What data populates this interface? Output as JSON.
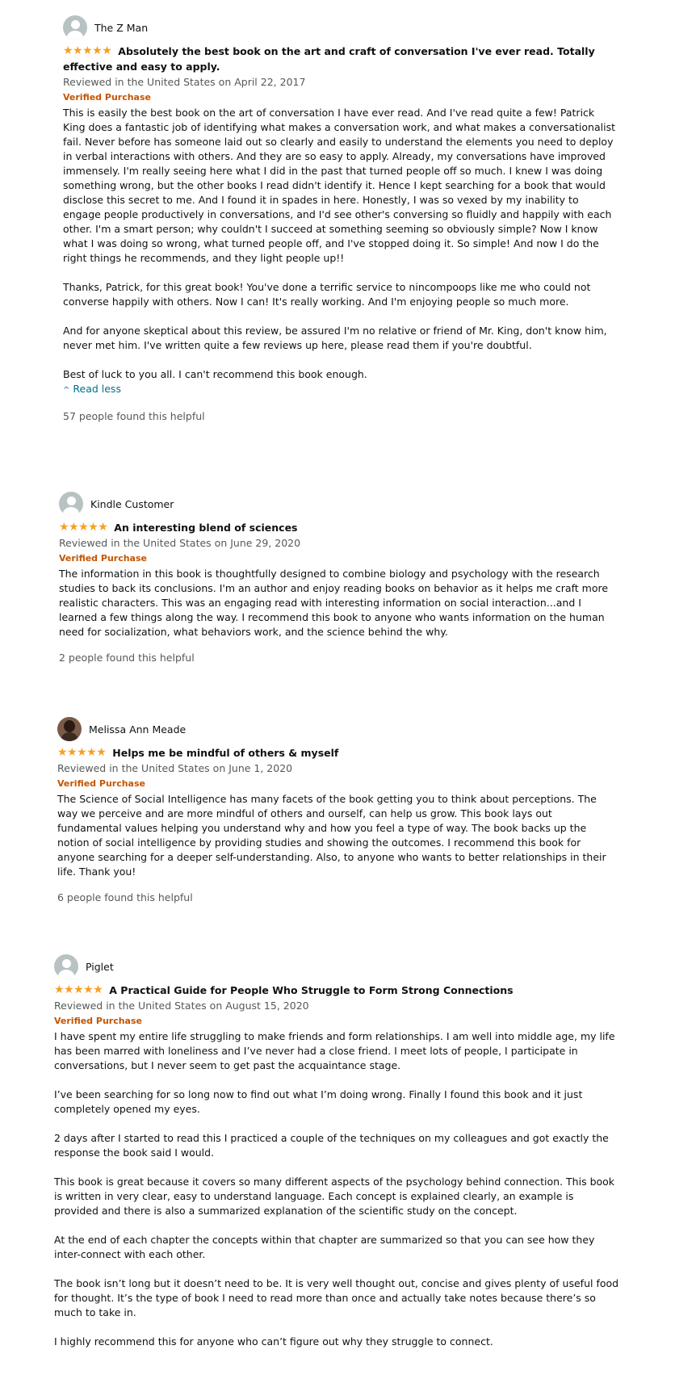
{
  "reviews": [
    {
      "profile_name": "The Z Man",
      "stars": "★★★★★",
      "title": "Absolutely the best book on the art and craft of conversation I've ever read. Totally effective and easy to apply.",
      "date": "Reviewed in the United States on April 22, 2017",
      "verified": "Verified Purchase",
      "paragraphs": [
        "This is easily the best book on the art of conversation I have ever read. And I've read quite a few! Patrick King does a fantastic job of identifying what makes a conversation work, and what makes a conversationalist fail. Never before has someone laid out so clearly and easily to understand the elements you need to deploy in verbal interactions with others. And they are so easy to apply. Already, my conversations have improved immensely. I'm really seeing here what I did in the past that turned people off so much. I knew I was doing something wrong, but the other books I read didn't identify it. Hence I kept searching for a book that would disclose this secret to me. And I found it in spades in here. Honestly, I was so vexed by my inability to engage people productively in conversations, and I'd see other's conversing so fluidly and happily with each other. I'm a smart person; why couldn't I succeed at something seeming so obviously simple? Now I know what I was doing so wrong, what turned people off, and I've stopped doing it. So simple! And now I do the right things he recommends, and they light people up!!",
        "Thanks, Patrick, for this great book! You've done a terrific service to nincompoops like me who could not converse happily with others. Now I can! It's really working. And I'm enjoying people so much more.",
        "And for anyone skeptical about this review, be assured I'm no relative or friend of Mr. King, don't know him, never met him. I've written quite a few reviews up here, please read them if you're doubtful.",
        "Best of luck to you all. I can't recommend this book enough."
      ],
      "read_less": "Read less",
      "helpful": "57 people found this helpful"
    },
    {
      "profile_name": "Kindle Customer",
      "stars": "★★★★★",
      "title": "An interesting blend of sciences",
      "date": "Reviewed in the United States on June 29, 2020",
      "verified": "Verified Purchase",
      "paragraphs": [
        "The information in this book is thoughtfully designed to combine biology and psychology with the research studies to back its conclusions. I'm an author and enjoy reading books on behavior as it helps me craft more realistic characters. This was an engaging read with interesting information on social interaction...and I learned a few things along the way. I recommend this book to anyone who wants information on the human need for socialization, what behaviors work, and the science behind the why."
      ],
      "helpful": "2 people found this helpful"
    },
    {
      "profile_name": "Melissa Ann Meade",
      "stars": "★★★★★",
      "title": "Helps me be mindful of others & myself",
      "date": "Reviewed in the United States on June 1, 2020",
      "verified": "Verified Purchase",
      "paragraphs": [
        "The Science of Social Intelligence has many facets of the book getting you to think about perceptions. The way we perceive and are more mindful of others and ourself, can help us grow. This book lays out fundamental values helping you understand why and how you feel a type of way. The book backs up the notion of social intelligence by providing studies and showing the outcomes. I recommend this book for anyone searching for a deeper self-understanding. Also, to anyone who wants to better relationships in their life. Thank you!"
      ],
      "helpful": "6 people found this helpful"
    },
    {
      "profile_name": "Piglet",
      "stars": "★★★★★",
      "title": "A Practical Guide for People Who Struggle to Form Strong Connections",
      "date": "Reviewed in the United States on August 15, 2020",
      "verified": "Verified Purchase",
      "paragraphs": [
        "I have spent my entire life struggling to make friends and form relationships. I am well into middle age, my life has been marred with loneliness and I’ve never had a close friend. I meet lots of people, I participate in conversations, but I never seem to get past the acquaintance stage.",
        "I’ve been searching for so long now to find out what I’m doing wrong. Finally I found this book and it just completely opened my eyes.",
        "2 days after I started to read this I practiced a couple of the techniques on my colleagues and got exactly the response the book said I would.",
        "This book is great because it covers so many different aspects of the psychology behind connection. This book is written in very clear, easy to understand language. Each concept is explained clearly, an example is provided and there is also a summarized explanation of the scientific study on the concept.",
        "At the end of each chapter the concepts within that chapter are summarized so that you can see how they inter-connect with each other.",
        "The book isn’t long but it doesn’t need to be. It is very well thought out, concise and gives plenty of useful food for thought. It’s the type of book I need to read more than once and actually take notes because there’s so much to take in.",
        "I highly recommend this for anyone who can’t figure out why they struggle to connect."
      ]
    }
  ]
}
